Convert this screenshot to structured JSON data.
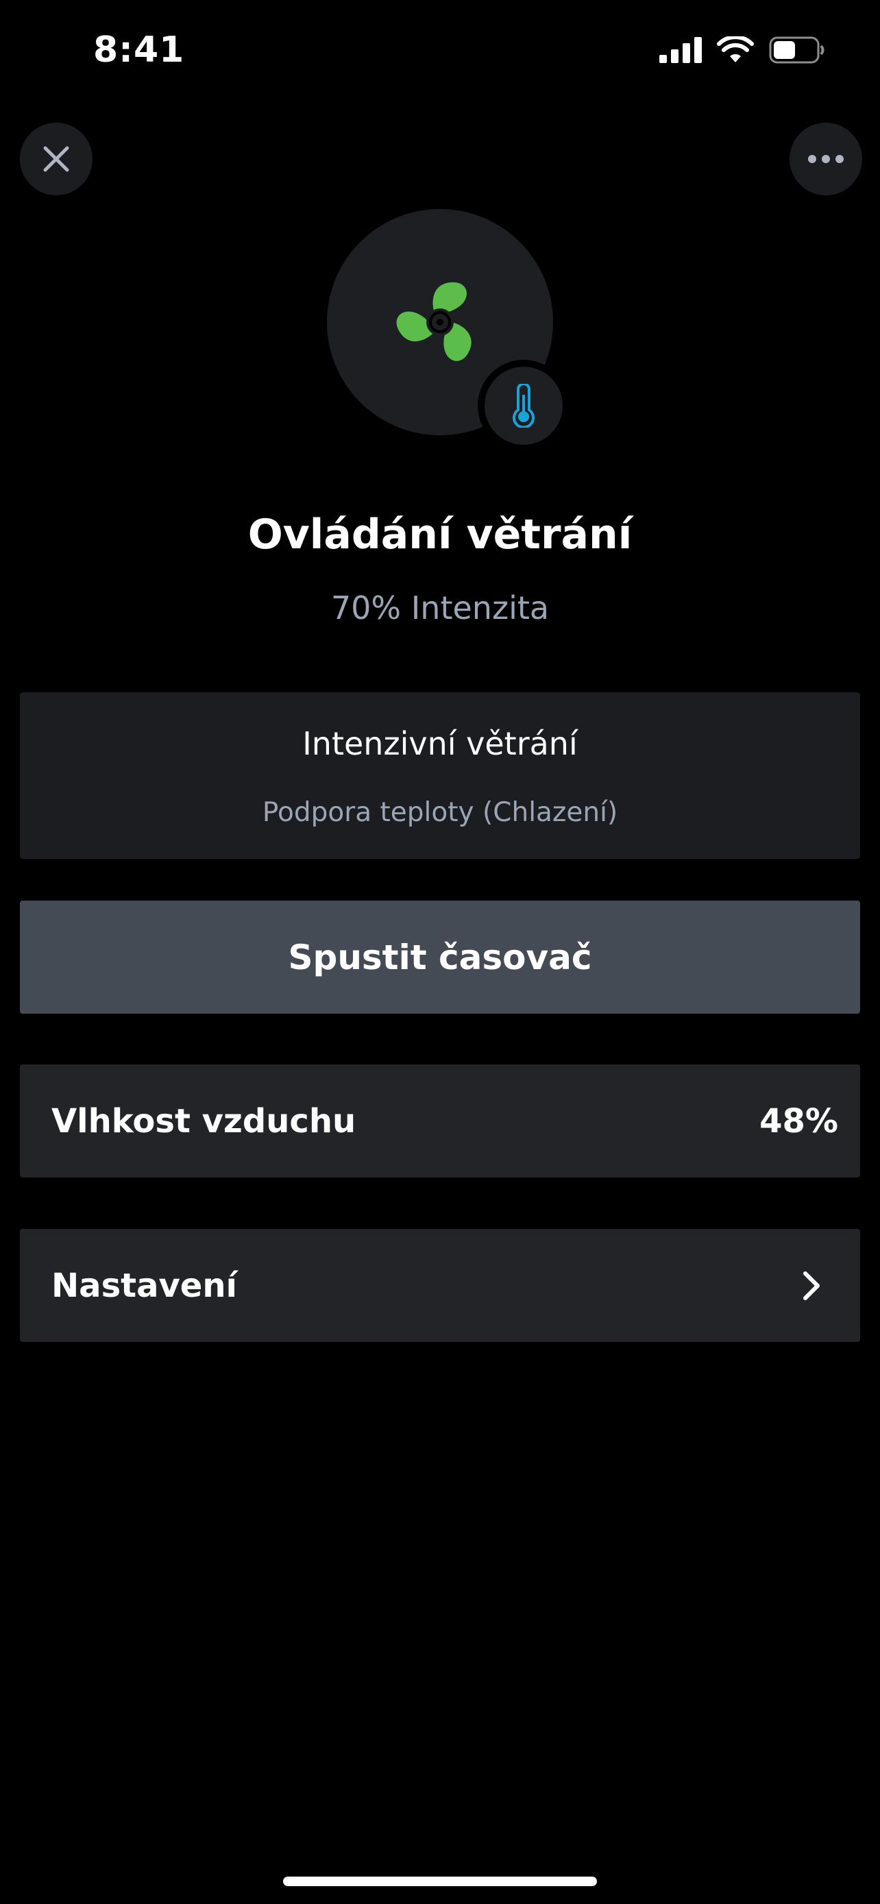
{
  "status_bar": {
    "time": "8:41",
    "icons": [
      "signal-icon",
      "wifi-icon",
      "battery-icon"
    ]
  },
  "header": {
    "close_icon": "close-icon",
    "more_icon": "more-icon"
  },
  "device": {
    "icon": "fan-icon",
    "badge_icon": "thermometer-icon",
    "icon_color": "#5dbd4a",
    "badge_color": "#1aa3d9",
    "title": "Ovládání větrání",
    "intensity": "70% Intenzita"
  },
  "mode": {
    "label": "Intenzivní větrání",
    "detail": "Podpora teploty (Chlazení)"
  },
  "timer": {
    "label": "Spustit časovač"
  },
  "humidity": {
    "label": "Vlhkost vzduchu",
    "value": "48%"
  },
  "settings": {
    "label": "Nastavení",
    "chevron_icon": "chevron-right-icon"
  }
}
